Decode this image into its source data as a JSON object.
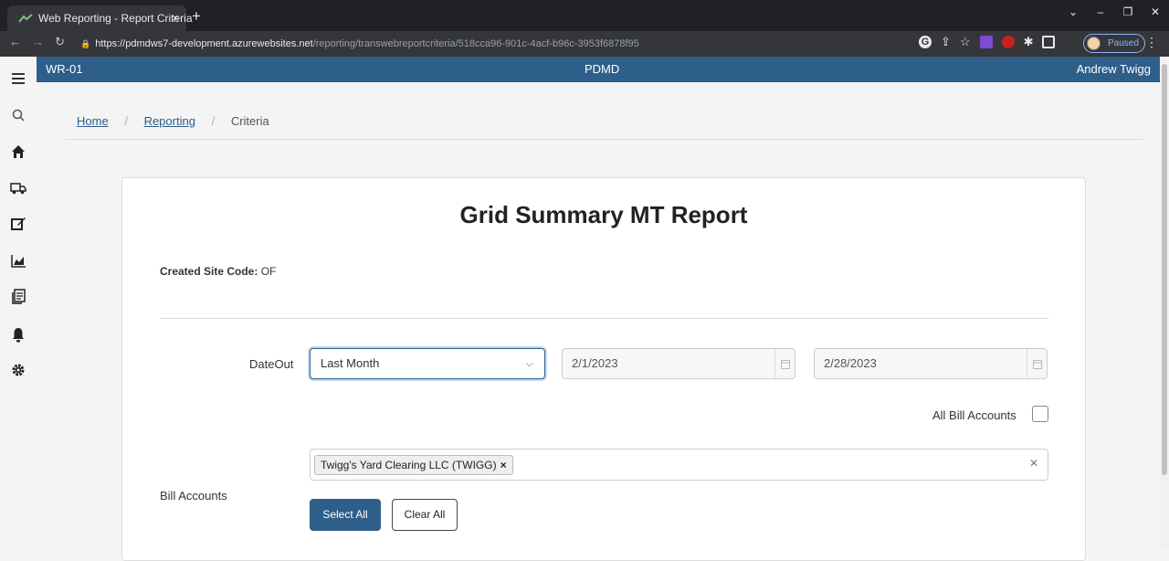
{
  "browser": {
    "tab_title": "Web Reporting - Report Criteria",
    "tab_close": "×",
    "new_tab": "+",
    "url_host": "https://pdmdws7-development.azurewebsites.net",
    "url_path": "/reporting/transwebreportcriteria/518cca96-901c-4acf-b96c-3953f6878f95",
    "profile_status": "Paused",
    "win_controls": [
      "⌄",
      "–",
      "❐",
      "✕"
    ]
  },
  "appbar": {
    "left": "WR-01",
    "center": "PDMD",
    "user": "Andrew Twigg"
  },
  "sidebar": {
    "icons": [
      "menu-icon",
      "search-icon",
      "home-icon",
      "truck-icon",
      "edit-icon",
      "chart-icon",
      "document-icon",
      "bell-icon",
      "gear-icon"
    ]
  },
  "breadcrumb": {
    "home": "Home",
    "reporting": "Reporting",
    "current": "Criteria",
    "separator": "/"
  },
  "report": {
    "title": "Grid Summary MT Report",
    "site_code_label": "Created Site Code:",
    "site_code_value": "OF"
  },
  "form": {
    "dateout_label": "DateOut",
    "dateout_selected": "Last Month",
    "date_from": "2/1/2023",
    "date_to": "2/28/2023",
    "all_bill_accounts_label": "All Bill Accounts",
    "all_bill_accounts_checked": false,
    "bill_accounts_label": "Bill Accounts",
    "bill_accounts_selected": [
      "Twigg's Yard Clearing LLC (TWIGG)"
    ],
    "chip_remove": "×",
    "clear_symbol": "✕",
    "select_all_label": "Select All",
    "clear_all_label": "Clear All"
  },
  "colors": {
    "brand": "#2e5e8a"
  }
}
